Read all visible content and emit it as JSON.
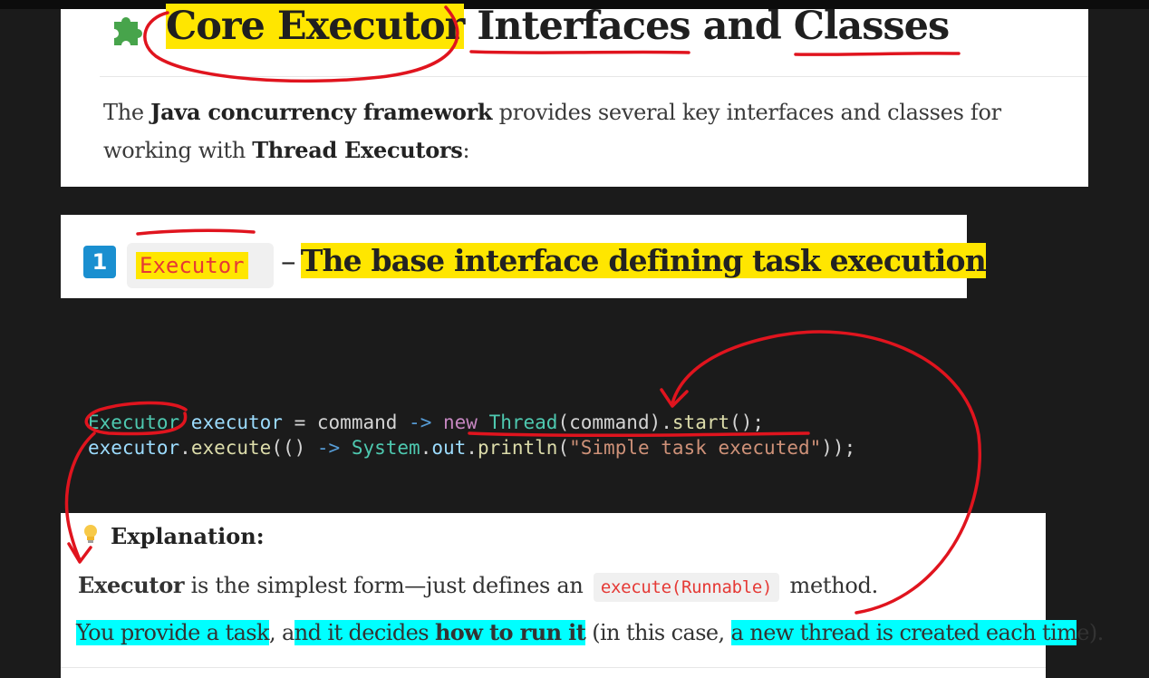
{
  "heading": {
    "part1": "Core Executor",
    "part2": " Interfaces and Classes"
  },
  "intro": {
    "prefix": "The ",
    "bold1": "Java concurrency framework",
    "middle": " provides several key interfaces and classes for working with ",
    "bold2": "Thread Executors",
    "suffix": ":"
  },
  "section": {
    "number": "1",
    "code_label": "Executor",
    "dash": "–",
    "title": "The base interface defining task execution"
  },
  "code": {
    "l1_type": "Executor",
    "l1_var": " executor",
    "l1_eq": " = ",
    "l1_param": "command",
    "l1_arrow": " -> ",
    "l1_new": "new",
    "l1_cls": " Thread",
    "l1_open": "(",
    "l1_arg": "command",
    "l1_close": ").",
    "l1_start": "start",
    "l1_end": "();",
    "l2_var": "executor",
    "l2_dot": ".",
    "l2_exec": "execute",
    "l2_open": "(()",
    "l2_arrow": " -> ",
    "l2_sys": "System",
    "l2_dot2": ".",
    "l2_out": "out",
    "l2_dot3": ".",
    "l2_println": "println",
    "l2_paren": "(",
    "l2_str": "\"Simple task executed\"",
    "l2_end": "));"
  },
  "explanation": {
    "title": "Explanation:",
    "line1_bold": "Executor",
    "line1_text": " is the simplest form—just defines an ",
    "line1_code": "execute(Runnable)",
    "line1_end": " method.",
    "line2_hl1": "You provide a task",
    "line2_comma": ", ",
    "line2_a": "a",
    "line2_hl2a": "nd it decides ",
    "line2_hl2b": "how to run it",
    "line2_mid": " (in this case, ",
    "line2_hl3": "a new thread is created each tim",
    "line2_end": "e)."
  },
  "colors": {
    "highlight_yellow": "#ffe600",
    "highlight_cyan": "#00ffff",
    "annotation_red": "#e0141e",
    "badge_blue": "#1a8fd0"
  },
  "icons": [
    "puzzle-icon",
    "number-one-badge",
    "lightbulb-icon"
  ]
}
